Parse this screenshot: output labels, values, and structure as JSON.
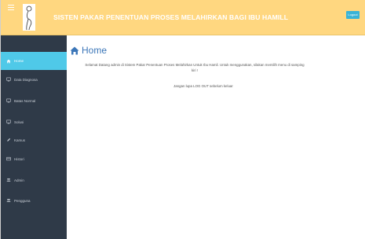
{
  "header": {
    "title": "SISTEN PAKAR PENENTUAN PROSES MELAHIRKAN BAGI IBU HAMILL",
    "logout_label": "Logout",
    "menu_icon": "hamburger-icon",
    "logo_icon": "pregnant-woman-logo"
  },
  "sidebar": {
    "items": [
      {
        "label": "Home",
        "icon": "home-icon",
        "active": true
      },
      {
        "label": "Data Diagnosa",
        "icon": "monitor-icon",
        "active": false
      },
      {
        "label": "Batas Normal",
        "icon": "monitor-icon",
        "active": false
      },
      {
        "label": "Solusi",
        "icon": "monitor-icon",
        "active": false
      },
      {
        "label": "Kamus",
        "icon": "pencil-icon",
        "active": false
      },
      {
        "label": "Histori",
        "icon": "table-icon",
        "active": false
      },
      {
        "label": "Admin",
        "icon": "users-icon",
        "active": false
      },
      {
        "label": "Pengguna",
        "icon": "users-icon",
        "active": false
      }
    ]
  },
  "main": {
    "page_title": "Home",
    "welcome_text": "Selamat Datang admin di Sistem Pakar Penentuan Proses Melahirkan Untuk Ibu Hamil. Untuk menggunakan, silakan memilih menu di samping kiri !",
    "reminder_text": "Jangan lupa LOG OUT sebelum keluar"
  },
  "colors": {
    "header_bg": "#ffd780",
    "sidebar_bg": "#2f3a48",
    "active_item": "#4fc9e8",
    "logout_button": "#39b3d7",
    "title_blue": "#3b76b8"
  }
}
